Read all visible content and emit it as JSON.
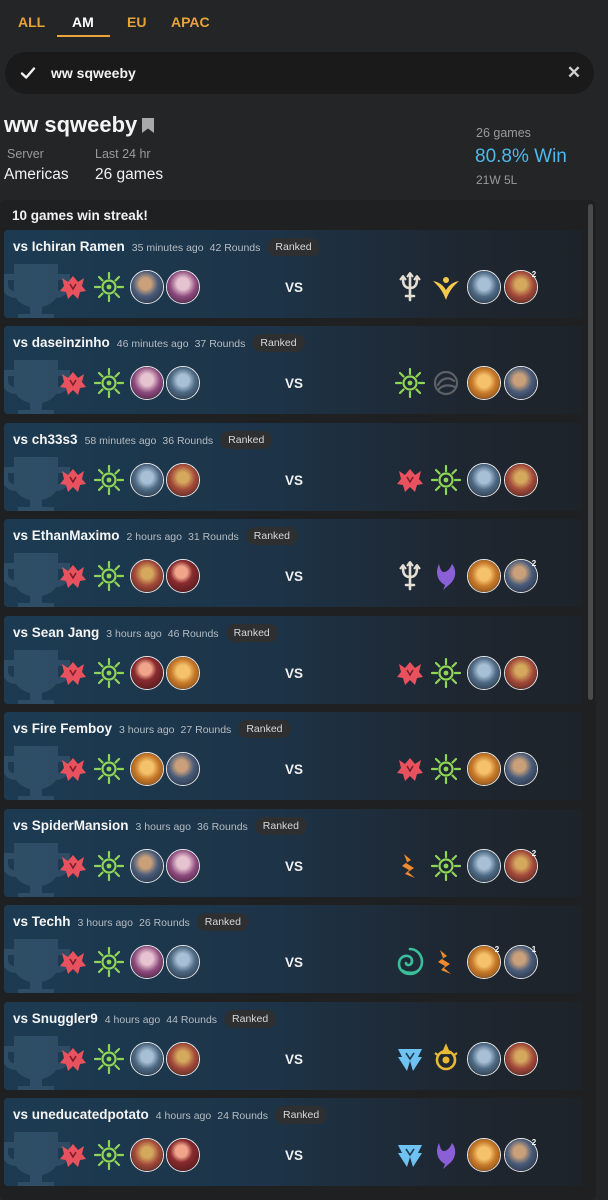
{
  "tabs": [
    {
      "label": "ALL",
      "active": false
    },
    {
      "label": "AM",
      "active": true
    },
    {
      "label": "EU",
      "active": false
    },
    {
      "label": "APAC",
      "active": false
    }
  ],
  "search": {
    "value": "ww sqweeby"
  },
  "player": {
    "name": "ww sqweeby",
    "server_label": "Server",
    "server": "Americas",
    "recent_label": "Last 24 hr",
    "recent": "26 games",
    "games_total": "26 games",
    "winrate": "80.8% Win",
    "record": "21W 5L"
  },
  "streak_text": "10 games win streak!",
  "colors": {
    "accent": "#e8a33a",
    "win": "#4fb8ea"
  },
  "matches": [
    {
      "opponent": "vs Ichiran Ramen",
      "time": "35 minutes ago",
      "rounds": "42 Rounds",
      "badge": "Ranked",
      "vs": "VS",
      "player_icons": [
        "noxus-region-icon",
        "shurima-region-icon",
        "champion-portrait",
        "champion-portrait"
      ],
      "opponent_icons": [
        "bilgewater-region-icon",
        "targon-region-icon",
        "champion-portrait",
        "champion-portrait"
      ],
      "opponent_levels": [
        "",
        "2"
      ]
    },
    {
      "opponent": "vs daseinzinho",
      "time": "46 minutes ago",
      "rounds": "37 Rounds",
      "badge": "Ranked",
      "vs": "VS",
      "player_icons": [
        "noxus-region-icon",
        "shurima-region-icon",
        "champion-portrait",
        "champion-portrait"
      ],
      "opponent_icons": [
        "shurima-region-icon",
        "shadow-isles-region-icon",
        "champion-portrait",
        "champion-portrait"
      ],
      "opponent_levels": [
        "",
        ""
      ]
    },
    {
      "opponent": "vs ch33s3",
      "time": "58 minutes ago",
      "rounds": "36 Rounds",
      "badge": "Ranked",
      "vs": "VS",
      "player_icons": [
        "noxus-region-icon",
        "shurima-region-icon",
        "champion-portrait",
        "champion-portrait"
      ],
      "opponent_icons": [
        "noxus-region-icon",
        "shurima-region-icon",
        "champion-portrait",
        "champion-portrait"
      ],
      "opponent_levels": [
        "",
        ""
      ]
    },
    {
      "opponent": "vs EthanMaximo",
      "time": "2 hours ago",
      "rounds": "31 Rounds",
      "badge": "Ranked",
      "vs": "VS",
      "player_icons": [
        "noxus-region-icon",
        "shurima-region-icon",
        "champion-portrait",
        "champion-portrait"
      ],
      "opponent_icons": [
        "bilgewater-region-icon",
        "runeterra-region-icon",
        "champion-portrait",
        "champion-portrait"
      ],
      "opponent_levels": [
        "",
        "2"
      ]
    },
    {
      "opponent": "vs Sean Jang",
      "time": "3 hours ago",
      "rounds": "46 Rounds",
      "badge": "Ranked",
      "vs": "VS",
      "player_icons": [
        "noxus-region-icon",
        "shurima-region-icon",
        "champion-portrait",
        "champion-portrait"
      ],
      "opponent_icons": [
        "noxus-region-icon",
        "shurima-region-icon",
        "champion-portrait",
        "champion-portrait"
      ],
      "opponent_levels": [
        "",
        ""
      ]
    },
    {
      "opponent": "vs Fire Femboy",
      "time": "3 hours ago",
      "rounds": "27 Rounds",
      "badge": "Ranked",
      "vs": "VS",
      "player_icons": [
        "noxus-region-icon",
        "shurima-region-icon",
        "champion-portrait",
        "champion-portrait"
      ],
      "opponent_icons": [
        "noxus-region-icon",
        "shurima-region-icon",
        "champion-portrait",
        "champion-portrait"
      ],
      "opponent_levels": [
        "",
        ""
      ]
    },
    {
      "opponent": "vs SpiderMansion",
      "time": "3 hours ago",
      "rounds": "36 Rounds",
      "badge": "Ranked",
      "vs": "VS",
      "player_icons": [
        "noxus-region-icon",
        "shurima-region-icon",
        "champion-portrait",
        "champion-portrait"
      ],
      "opponent_icons": [
        "piltover-region-icon",
        "shurima-region-icon",
        "champion-portrait",
        "champion-portrait"
      ],
      "opponent_levels": [
        "",
        "2"
      ]
    },
    {
      "opponent": "vs Techh",
      "time": "3 hours ago",
      "rounds": "26 Rounds",
      "badge": "Ranked",
      "vs": "VS",
      "player_icons": [
        "noxus-region-icon",
        "shurima-region-icon",
        "champion-portrait",
        "champion-portrait"
      ],
      "opponent_icons": [
        "ionia-region-icon",
        "piltover-region-icon",
        "champion-portrait",
        "champion-portrait"
      ],
      "opponent_levels": [
        "2",
        "1"
      ]
    },
    {
      "opponent": "vs Snuggler9",
      "time": "4 hours ago",
      "rounds": "44 Rounds",
      "badge": "Ranked",
      "vs": "VS",
      "player_icons": [
        "noxus-region-icon",
        "shurima-region-icon",
        "champion-portrait",
        "champion-portrait"
      ],
      "opponent_icons": [
        "freljord-region-icon",
        "demacia-region-icon",
        "champion-portrait",
        "champion-portrait"
      ],
      "opponent_levels": [
        "",
        ""
      ]
    },
    {
      "opponent": "vs uneducatedpotato",
      "time": "4 hours ago",
      "rounds": "24 Rounds",
      "badge": "Ranked",
      "vs": "VS",
      "player_icons": [
        "noxus-region-icon",
        "shurima-region-icon",
        "champion-portrait",
        "champion-portrait"
      ],
      "opponent_icons": [
        "freljord-region-icon",
        "runeterra-region-icon",
        "champion-portrait",
        "champion-portrait"
      ],
      "opponent_levels": [
        "",
        "2"
      ]
    }
  ]
}
